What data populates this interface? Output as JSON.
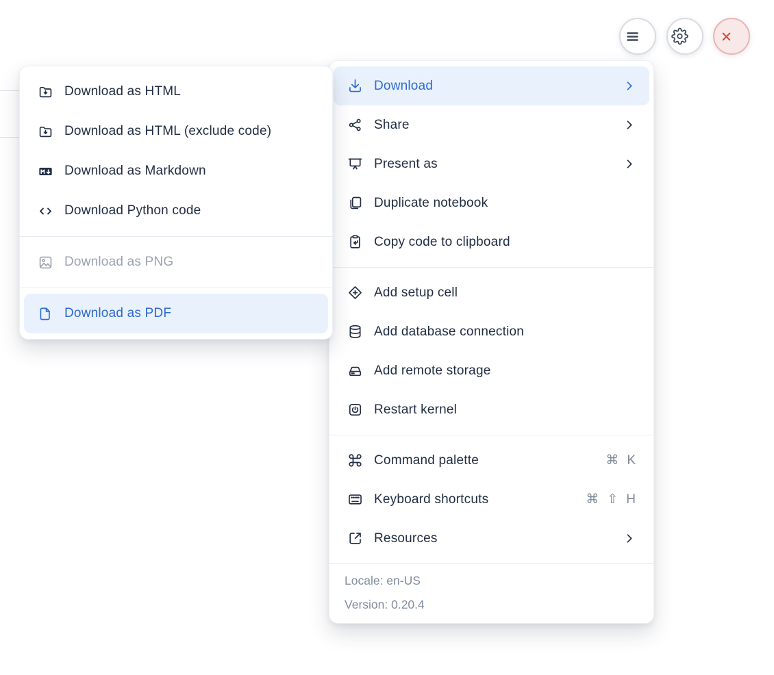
{
  "header": {
    "buttons": [
      {
        "id": "hamburger",
        "icon": "hamburger-icon"
      },
      {
        "id": "settings",
        "icon": "gear-icon"
      },
      {
        "id": "close",
        "icon": "close-icon"
      }
    ]
  },
  "submenu": {
    "sections": [
      {
        "items": [
          {
            "id": "download-as-html",
            "icon": "folder-download-icon",
            "label": "Download as HTML"
          },
          {
            "id": "download-as-html-exclude-code",
            "icon": "folder-download-icon",
            "label": "Download as HTML (exclude code)"
          },
          {
            "id": "download-as-markdown",
            "icon": "markdown-icon",
            "label": "Download as Markdown"
          },
          {
            "id": "download-python-code",
            "icon": "code-icon",
            "label": "Download Python code"
          }
        ]
      },
      {
        "items": [
          {
            "id": "download-as-png",
            "icon": "image-icon",
            "label": "Download as PNG",
            "state": "disabled"
          }
        ]
      },
      {
        "items": [
          {
            "id": "download-as-pdf",
            "icon": "file-icon",
            "label": "Download as PDF",
            "state": "active"
          }
        ]
      }
    ]
  },
  "menu": {
    "sections": [
      {
        "items": [
          {
            "id": "download",
            "icon": "download-icon",
            "label": "Download",
            "state": "active",
            "trailing": "chevron"
          },
          {
            "id": "share",
            "icon": "share-icon",
            "label": "Share",
            "trailing": "chevron"
          },
          {
            "id": "present-as",
            "icon": "present-icon",
            "label": "Present as",
            "trailing": "chevron"
          },
          {
            "id": "duplicate-notebook",
            "icon": "duplicate-icon",
            "label": "Duplicate notebook"
          },
          {
            "id": "copy-code-to-clipboard",
            "icon": "clipboard-copy-icon",
            "label": "Copy code to clipboard"
          }
        ]
      },
      {
        "items": [
          {
            "id": "add-setup-cell",
            "icon": "setup-cell-icon",
            "label": "Add setup cell"
          },
          {
            "id": "add-database-connection",
            "icon": "database-icon",
            "label": "Add database connection"
          },
          {
            "id": "add-remote-storage",
            "icon": "storage-icon",
            "label": "Add remote storage"
          },
          {
            "id": "restart-kernel",
            "icon": "restart-icon",
            "label": "Restart kernel"
          }
        ]
      },
      {
        "items": [
          {
            "id": "command-palette",
            "icon": "command-icon",
            "label": "Command palette",
            "trailing": "shortcut",
            "shortcut": [
              "⌘",
              "K"
            ]
          },
          {
            "id": "keyboard-shortcuts",
            "icon": "keyboard-icon",
            "label": "Keyboard shortcuts",
            "trailing": "shortcut",
            "shortcut": [
              "⌘",
              "⇧",
              "H"
            ]
          },
          {
            "id": "resources",
            "icon": "external-link-icon",
            "label": "Resources",
            "trailing": "chevron"
          }
        ]
      }
    ],
    "footer": {
      "locale": "Locale: en-US",
      "version": "Version: 0.20.4"
    }
  },
  "colors": {
    "accent": "#2F6AD0",
    "accent_bg": "#E9F1FC",
    "text": "#222E43",
    "muted": "#7E8898",
    "disabled": "#9AA3B0",
    "footer_text": "#828E9E",
    "divider": "#E7EBF0",
    "danger": "#C8473F",
    "danger_bg": "#F9E8E8",
    "danger_border": "#EDB4B1",
    "circle_border": "#D9DCE1",
    "icon_dark": "#3E4759"
  }
}
